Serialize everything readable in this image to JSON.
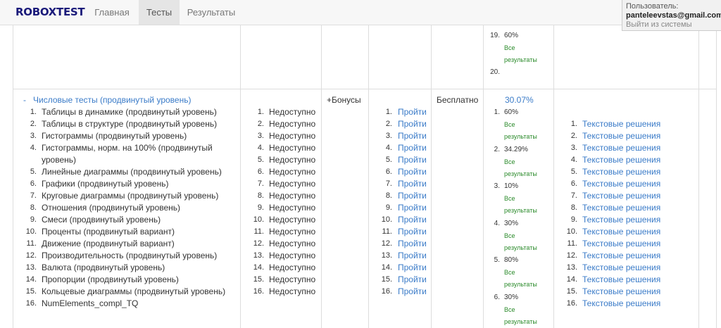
{
  "navbar": {
    "brand": "ROBOXTEST",
    "items": [
      {
        "label": "Главная",
        "active": false
      },
      {
        "label": "Тесты",
        "active": true
      },
      {
        "label": "Результаты",
        "active": false
      }
    ]
  },
  "user": {
    "label": "Пользователь:",
    "email": "panteleevstas@gmail.com",
    "logout": "Выйти из системы"
  },
  "prev_row": {
    "result_19_num": "19.",
    "result_19_value": "60%",
    "all_results_line1": "Все",
    "all_results_line2": "результаты",
    "result_20_num": "20."
  },
  "section": {
    "toggle": "-",
    "title": "Числовые тесты (продвинутый уровень)",
    "bonus": "+Бонусы",
    "price": "Бесплатно",
    "score": "30.07%",
    "tests": [
      {
        "n": "1.",
        "name": "Таблицы в динамике (продвинутый уровень)"
      },
      {
        "n": "2.",
        "name": "Таблицы в структуре (продвинутый уровень)"
      },
      {
        "n": "3.",
        "name": "Гистограммы (продвинутый уровень)"
      },
      {
        "n": "4.",
        "name": "Гистограммы, норм. на 100% (продвинутый",
        "name2": "уровень)"
      },
      {
        "n": "5.",
        "name": "Линейные диаграммы (продвинутый уровень)"
      },
      {
        "n": "6.",
        "name": "Графики (продвинутый уровень)"
      },
      {
        "n": "7.",
        "name": "Круговые диаграммы (продвинутый уровень)"
      },
      {
        "n": "8.",
        "name": "Отношения (продвинутый уровень)"
      },
      {
        "n": "9.",
        "name": "Смеси (продвинутый уровень)"
      },
      {
        "n": "10.",
        "name": "Проценты (продвинутый вариант)"
      },
      {
        "n": "11.",
        "name": "Движение (продвинутый вариант)"
      },
      {
        "n": "12.",
        "name": "Производительность (продвинутый уровень)"
      },
      {
        "n": "13.",
        "name": "Валюта (продвинутый уровень)"
      },
      {
        "n": "14.",
        "name": "Пропорции (продвинутый уровень)"
      },
      {
        "n": "15.",
        "name": "Кольцевые диаграммы (продвинутый уровень)"
      },
      {
        "n": "16.",
        "name": "NumElements_compl_TQ"
      }
    ],
    "availability": [
      "Недоступно",
      "Недоступно",
      "Недоступно",
      "Недоступно",
      "Недоступно",
      "Недоступно",
      "Недоступно",
      "Недоступно",
      "Недоступно",
      "Недоступно",
      "Недоступно",
      "Недоступно",
      "Недоступно",
      "Недоступно",
      "Недоступно",
      "Недоступно"
    ],
    "take_label": "Пройти",
    "results": [
      {
        "n": "1.",
        "value": "60%"
      },
      {
        "n": "2.",
        "value": "34.29%"
      },
      {
        "n": "3.",
        "value": "10%"
      },
      {
        "n": "4.",
        "value": "30%"
      },
      {
        "n": "5.",
        "value": "80%"
      },
      {
        "n": "6.",
        "value": "30%"
      }
    ],
    "all_results_line1": "Все",
    "all_results_line2": "результаты",
    "solutions_label": "Текстовые решения"
  }
}
